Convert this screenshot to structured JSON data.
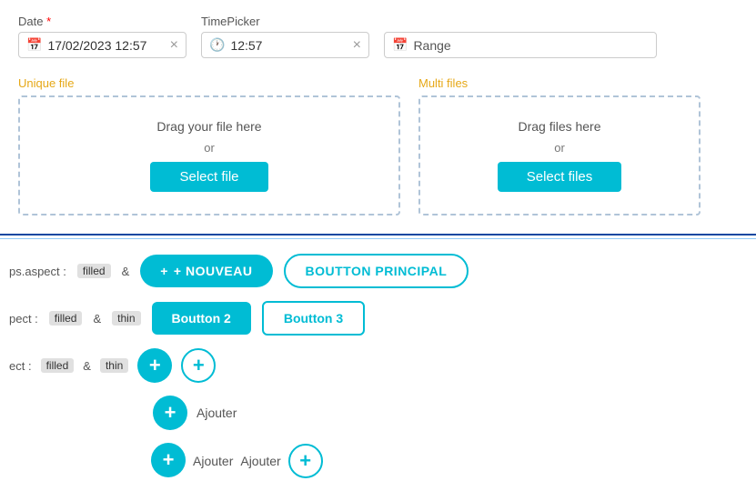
{
  "header": {
    "date_label": "Date",
    "date_required": "*",
    "date_value": "17/02/2023 12:57",
    "timepicker_label": "TimePicker",
    "time_value": "12:57",
    "range_label": "Range"
  },
  "file_sections": {
    "unique": {
      "label": "Unique file",
      "drag_text": "Drag your file here",
      "or_text": "or",
      "button_label": "Select file"
    },
    "multi": {
      "label": "Multi files",
      "drag_text": "Drag files here",
      "or_text": "or",
      "button_label": "Select files"
    }
  },
  "bottom": {
    "row1": {
      "label_text": "ps.aspect :",
      "badge1": "filled",
      "separator": "&",
      "btn_nouveau_label": "+ NOUVEAU",
      "btn_principal_label": "BOUTTON PRINCIPAL"
    },
    "row2": {
      "label_text": "pect :",
      "badge1": "filled",
      "separator": "&",
      "badge2": "thin",
      "btn2_label": "Boutton 2",
      "btn3_label": "Boutton 3"
    },
    "row3": {
      "label_text": "ect :",
      "badge1": "filled",
      "separator": "&",
      "badge2": "thin"
    },
    "row4": {
      "ajouter_label": "Ajouter"
    },
    "row5": {
      "ajouter_label1": "Ajouter",
      "ajouter_label2": "Ajouter"
    }
  }
}
